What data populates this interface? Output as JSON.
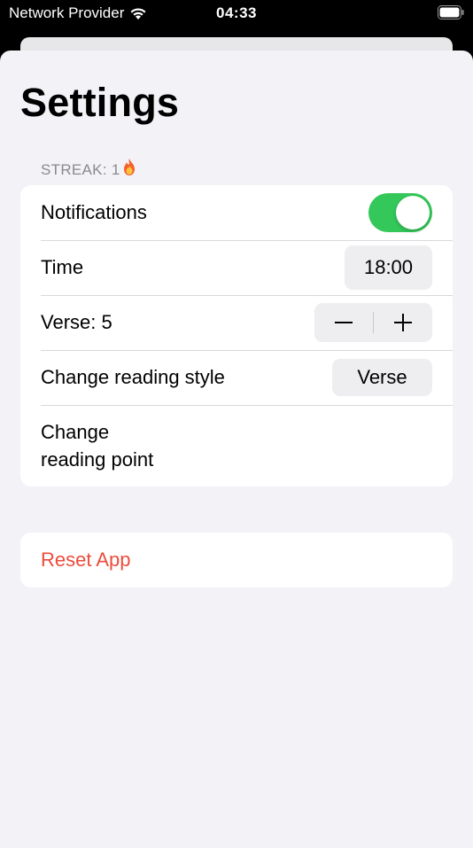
{
  "status_bar": {
    "carrier": "Network Provider",
    "time": "04:33",
    "icons": [
      "wifi-icon",
      "battery-icon"
    ]
  },
  "page": {
    "title": "Settings"
  },
  "streak": {
    "label": "STREAK: 1",
    "icon": "fire-icon"
  },
  "settings": {
    "notifications": {
      "label": "Notifications",
      "enabled": true
    },
    "time": {
      "label": "Time",
      "value": "18:00"
    },
    "verse": {
      "label": "Verse:  5",
      "minus_icon": "minus-icon",
      "plus_icon": "plus-icon"
    },
    "reading_style": {
      "label": "Change reading style",
      "value": "Verse"
    },
    "reading_point": {
      "label_line1": "Change",
      "label_line2": "reading point"
    }
  },
  "reset": {
    "label": "Reset App"
  },
  "colors": {
    "accent_green": "#34c759",
    "destructive": "#eb4d3d",
    "background": "#f2f2f7"
  }
}
